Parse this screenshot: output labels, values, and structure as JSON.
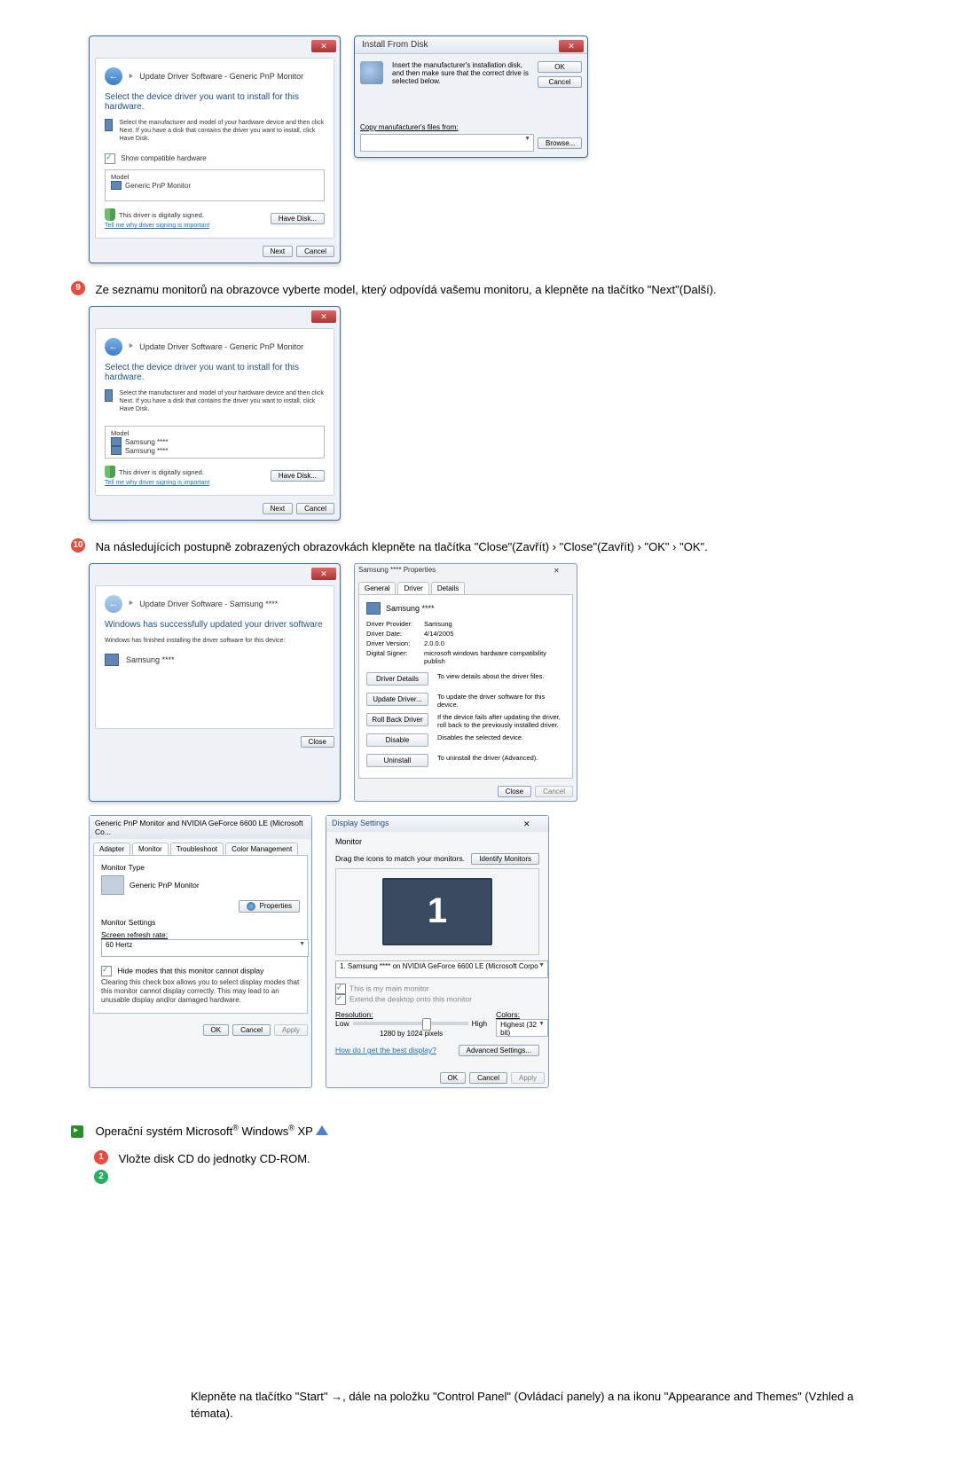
{
  "dialog_update1": {
    "breadcrumb": "Update Driver Software - Generic PnP Monitor",
    "title": "Select the device driver you want to install for this hardware.",
    "desc": "Select the manufacturer and model of your hardware device and then click Next. If you have a disk that contains the driver you want to install, click Have Disk.",
    "show_compat": "Show compatible hardware",
    "model_label": "Model",
    "item1": "Generic PnP Monitor",
    "signed": "This driver is digitally signed.",
    "tell_me": "Tell me why driver signing is important",
    "have_disk": "Have Disk...",
    "next": "Next",
    "cancel": "Cancel"
  },
  "install_disk": {
    "title": "Install From Disk",
    "desc": "Insert the manufacturer's installation disk, and then make sure that the correct drive is selected below.",
    "ok": "OK",
    "cancel": "Cancel",
    "copy_label": "Copy manufacturer's files from:",
    "browse": "Browse..."
  },
  "step9": "Ze seznamu monitorů na obrazovce vyberte model, který odpovídá vašemu monitoru, a klepněte na tlačítko \"Next\"(Další).",
  "dialog_update2": {
    "breadcrumb": "Update Driver Software - Generic PnP Monitor",
    "title": "Select the device driver you want to install for this hardware.",
    "desc": "Select the manufacturer and model of your hardware device and then click Next. If you have a disk that contains the driver you want to install, click Have Disk.",
    "model_label": "Model",
    "item1": "Samsung ****",
    "item2": "Samsung ****",
    "signed": "This driver is digitally signed.",
    "tell_me": "Tell me why driver signing is important",
    "have_disk": "Have Disk...",
    "next": "Next",
    "cancel": "Cancel"
  },
  "step10": "Na následujících postupně zobrazených obrazovkách klepněte na tlačítka \"Close\"(Zavřít) › \"Close\"(Zavřít) › \"OK\" › \"OK\".",
  "dialog_done": {
    "breadcrumb": "Update Driver Software - Samsung ****",
    "title": "Windows has successfully updated your driver software",
    "desc": "Windows has finished installing the driver software for this device:",
    "device": "Samsung ****",
    "close": "Close"
  },
  "props": {
    "title": "Samsung **** Properties",
    "tab_general": "General",
    "tab_driver": "Driver",
    "tab_details": "Details",
    "device": "Samsung ****",
    "provider_l": "Driver Provider:",
    "provider_v": "Samsung",
    "date_l": "Driver Date:",
    "date_v": "4/14/2005",
    "version_l": "Driver Version:",
    "version_v": "2.0.0.0",
    "signer_l": "Digital Signer:",
    "signer_v": "microsoft windows hardware compatibility publish",
    "btn_details": "Driver Details",
    "btn_details_d": "To view details about the driver files.",
    "btn_update": "Update Driver...",
    "btn_update_d": "To update the driver software for this device.",
    "btn_rollback": "Roll Back Driver",
    "btn_rollback_d": "If the device fails after updating the driver, roll back to the previously installed driver.",
    "btn_disable": "Disable",
    "btn_disable_d": "Disables the selected device.",
    "btn_uninstall": "Uninstall",
    "btn_uninstall_d": "To uninstall the driver (Advanced).",
    "close": "Close",
    "cancel": "Cancel"
  },
  "monprops": {
    "title": "Generic PnP Monitor and NVIDIA GeForce 6600 LE (Microsoft Co...",
    "tab_adapter": "Adapter",
    "tab_monitor": "Monitor",
    "tab_trouble": "Troubleshoot",
    "tab_color": "Color Management",
    "mtype": "Monitor Type",
    "gpnp": "Generic PnP Monitor",
    "btn_props": "Properties",
    "msettings": "Monitor Settings",
    "refresh": "Screen refresh rate:",
    "hz": "60 Hertz",
    "hide": "Hide modes that this monitor cannot display",
    "hide_desc": "Clearing this check box allows you to select display modes that this monitor cannot display correctly. This may lead to an unusable display and/or damaged hardware.",
    "ok": "OK",
    "cancel": "Cancel",
    "apply": "Apply"
  },
  "dispset": {
    "title": "Display Settings",
    "monitor": "Monitor",
    "drag": "Drag the icons to match your monitors.",
    "identify": "Identify Monitors",
    "sel_label": "1. Samsung **** on NVIDIA GeForce 6600 LE (Microsoft Corpo",
    "main_cb": "This is my main monitor",
    "extend_cb": "Extend the desktop onto this monitor",
    "res": "Resolution:",
    "low": "Low",
    "high": "High",
    "resval": "1280 by 1024 pixels",
    "colors": "Colors:",
    "colorval": "Highest (32 bit)",
    "howdo": "How do I get the best display?",
    "advanced": "Advanced Settings...",
    "ok": "OK",
    "cancel": "Cancel",
    "apply": "Apply"
  },
  "xp_heading_pre": "Operační systém Microsoft",
  "xp_heading_mid": " Windows",
  "xp_heading_post": " XP ",
  "xp_step1": "Vložte disk CD do jednotky CD-ROM.",
  "bottom": "Klepněte na tlačítko \"Start\" →, dále na položku \"Control Panel\" (Ovládací panely) a na ikonu \"Appearance and Themes\" (Vzhled a témata)."
}
